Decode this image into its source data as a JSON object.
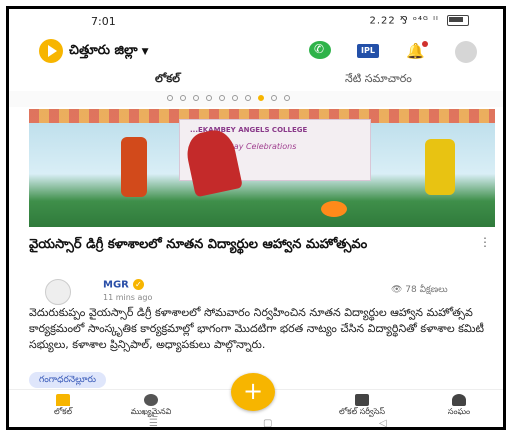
{
  "status": {
    "time": "7:01",
    "indicators": "2.22 ⅋ ᵒ⁴ᴳ ᴵᴵ"
  },
  "appbar": {
    "district": "చిత్తూరు జిల్లా",
    "icons": {
      "logo": "play-logo-icon",
      "whatsapp": "whatsapp-icon",
      "ipl": "IPL",
      "bell": "bell-icon",
      "profile": "profile-icon"
    }
  },
  "tabs": [
    {
      "label": "లోకల్"
    },
    {
      "label": "నేటి సమాచారం"
    }
  ],
  "carousel": {
    "dots": 10,
    "active_index": 7
  },
  "post": {
    "image_banner_line1": "...EKAMBEY ANGELS COLLEGE",
    "image_banner_line2": "...Day Celebrations",
    "headline": "వైయస్సార్ డిగ్రీ కళాశాలలో నూతన విద్యార్థుల ఆహ్వాన మహోత్సవం",
    "author": "MGR",
    "time_ago": "11 mins ago",
    "views": "👁 78 వీక్షణలు",
    "body": "వెదురుకుప్పం వైయస్సార్ డిగ్రీ కళాశాలలో సోమవారం నిర్వహించిన నూతన విద్యార్థుల ఆహ్వాన మహోత్సవ కార్యక్రమంలో సాంస్కృతిక కార్యక్రమాల్లో భాగంగా మొదటిగా భరత నాట్యం చేసిన విద్యార్థినితో కళాశాల కమిటీ సభ్యులు, కళాశాల ప్రిన్సిపాల్, అధ్యాపకులు పాల్గొన్నారు.",
    "tag": "గంగాధరనెల్లూరు"
  },
  "bottom_nav": [
    {
      "label": "లోకల్"
    },
    {
      "label": "ముఖ్యమైనవి"
    },
    {
      "label": "+"
    },
    {
      "label": "లోకల్ సర్వీసెస్"
    },
    {
      "label": "సంఘం"
    }
  ],
  "colors": {
    "accent": "#f7b500",
    "whatsapp": "#2fb34a",
    "ipl": "#2350a8",
    "link": "#2a4fa8"
  }
}
